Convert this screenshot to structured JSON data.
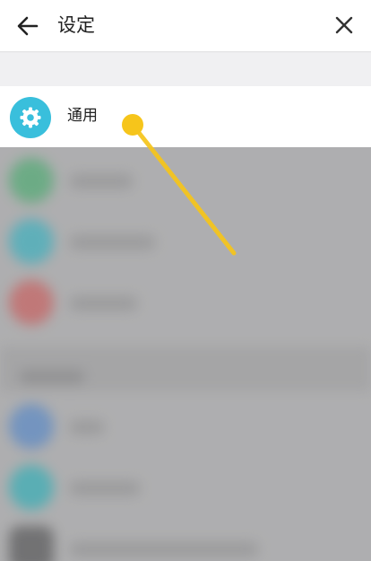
{
  "header": {
    "title": "设定",
    "back_icon": "arrow-left-icon",
    "close_icon": "close-icon"
  },
  "settings": {
    "general": {
      "label": "通用",
      "icon": "gear-icon",
      "icon_color": "#39bfdc"
    }
  },
  "colors": {
    "header_bg": "#ffffff",
    "dim_overlay": "#c7c7c9",
    "gesture_accent": "#f6c51b"
  }
}
